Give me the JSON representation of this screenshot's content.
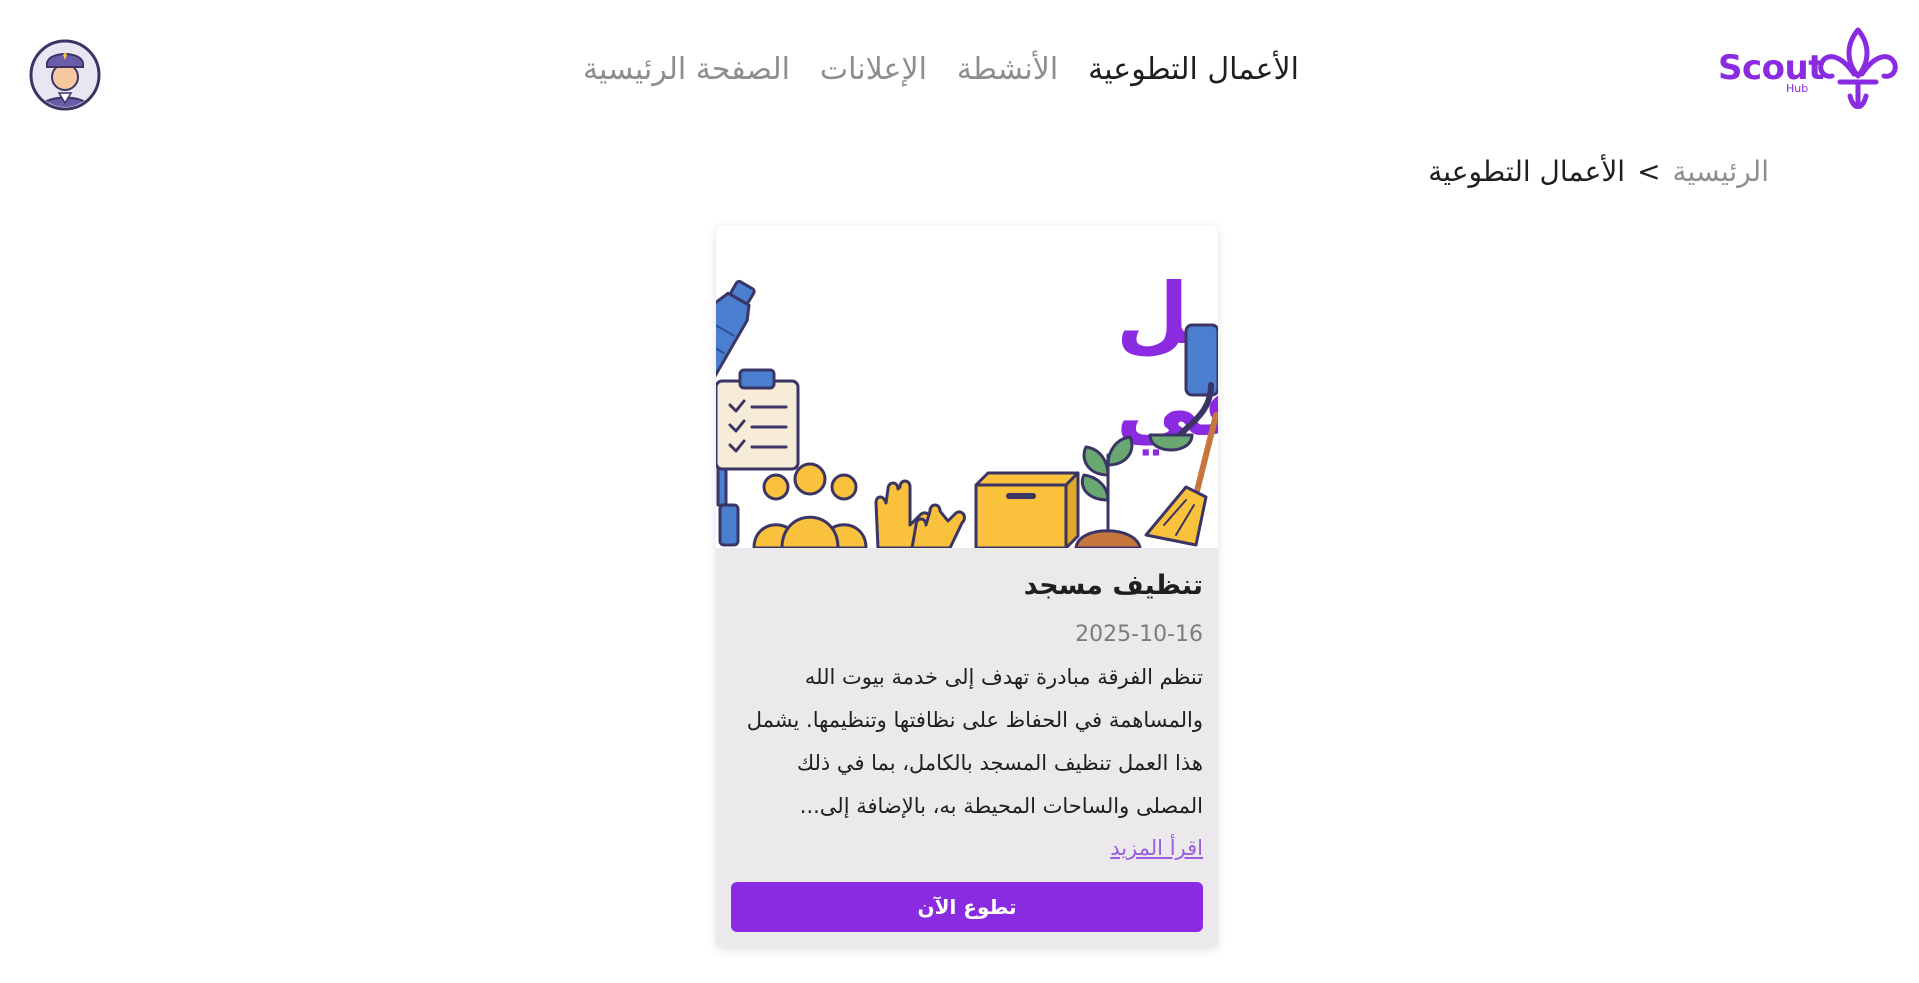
{
  "brand": {
    "name": "Scout",
    "sub": "Hub",
    "color": "#8a2be2"
  },
  "nav": {
    "items": [
      {
        "label": "الصفحة الرئيسية"
      },
      {
        "label": "الإعلانات"
      },
      {
        "label": "الأنشطة"
      },
      {
        "label": "الأعمال التطوعية"
      }
    ],
    "active_index": 3
  },
  "breadcrumb": {
    "home": "الرئيسية",
    "separator": ">",
    "current": "الأعمال التطوعية"
  },
  "card": {
    "image_heading_line1": "عمـــل",
    "image_heading_line2": "تطوعي",
    "title": "تنظيف مسجد",
    "date": "2025-10-16",
    "description": "تنظم الفرقة مبادرة تهدف إلى خدمة بيوت الله والمساهمة في الحفاظ على نظافتها وتنظيمها. يشمل هذا العمل تنظيف المسجد بالكامل، بما في ذلك المصلى والساحات المحيطة به، بالإضافة إلى...",
    "read_more": "اقرأ المزيد",
    "cta": "تطوع الآن"
  },
  "icons": [
    "fleur-de-lis-icon",
    "scout-avatar-icon",
    "water-bottle-icon",
    "clipboard-icon",
    "people-icon",
    "gloves-icon",
    "box-icon",
    "plant-icon",
    "ladle-icon",
    "broom-icon"
  ]
}
